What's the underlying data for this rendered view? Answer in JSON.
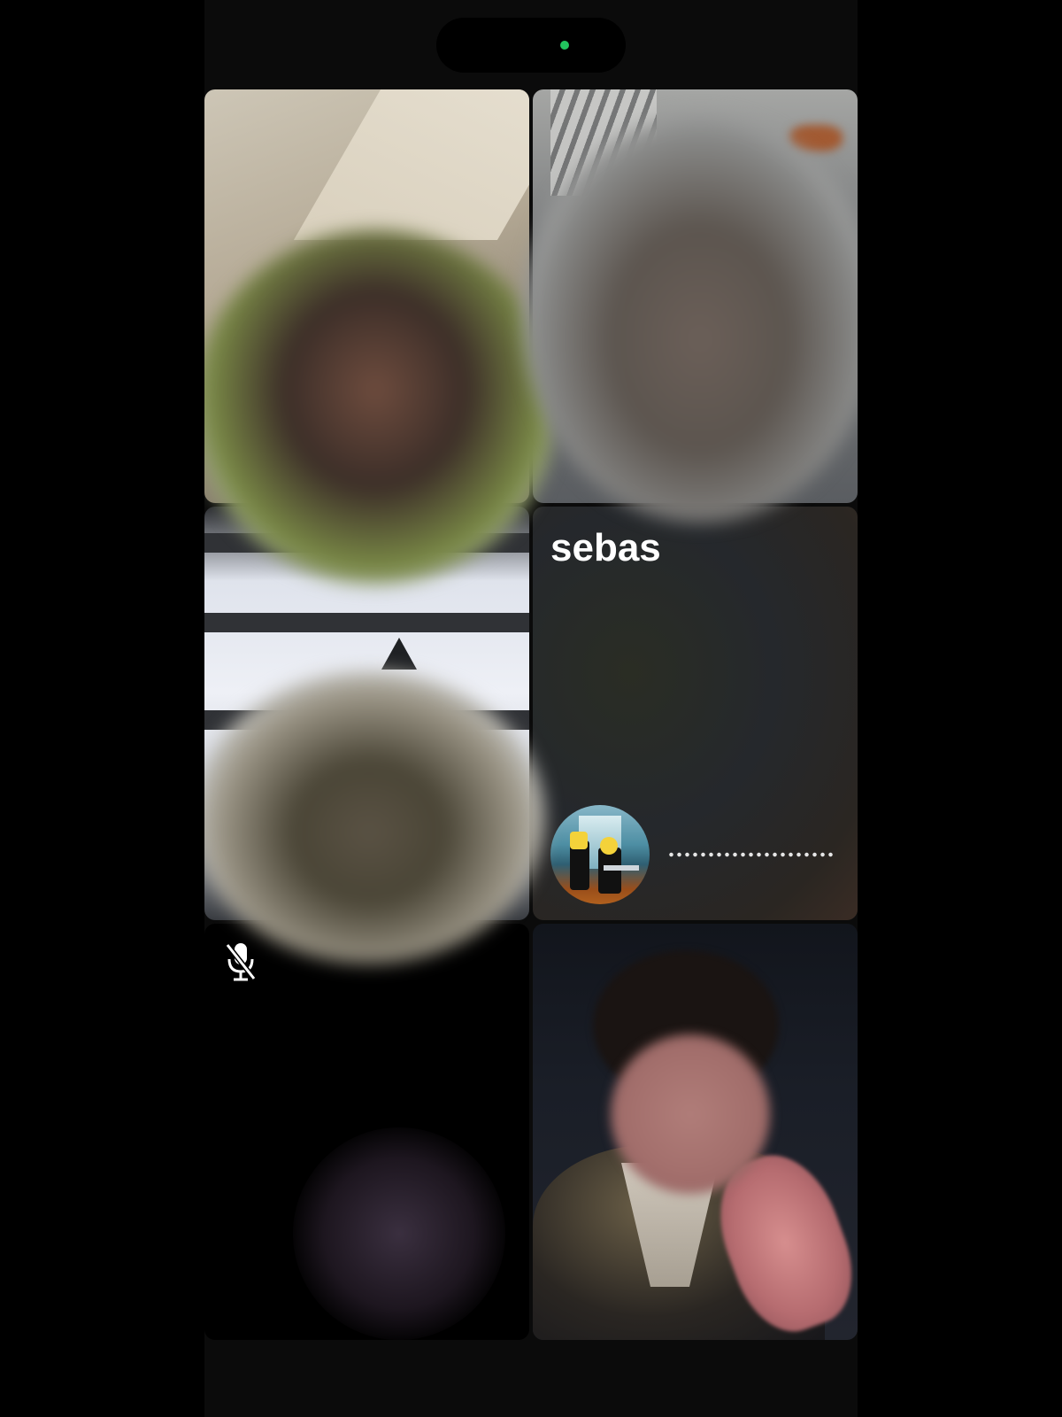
{
  "call": {
    "participants": [
      {
        "name": "",
        "tile": "top-left",
        "video": true,
        "muted": false
      },
      {
        "name": "",
        "tile": "top-right",
        "video": true,
        "muted": false
      },
      {
        "name": "",
        "tile": "middle-left",
        "video": true,
        "muted": true
      },
      {
        "name": "sebas",
        "tile": "middle-right",
        "video": false,
        "speaking_indicator": true
      },
      {
        "name": "",
        "tile": "bottom-left",
        "video": true,
        "muted": false
      },
      {
        "name": "",
        "tile": "bottom-right",
        "video": true,
        "muted": false
      }
    ],
    "sebas_label": "sebas",
    "mic_icon": "mic-off-icon",
    "status_dot_color": "#22c55e"
  }
}
